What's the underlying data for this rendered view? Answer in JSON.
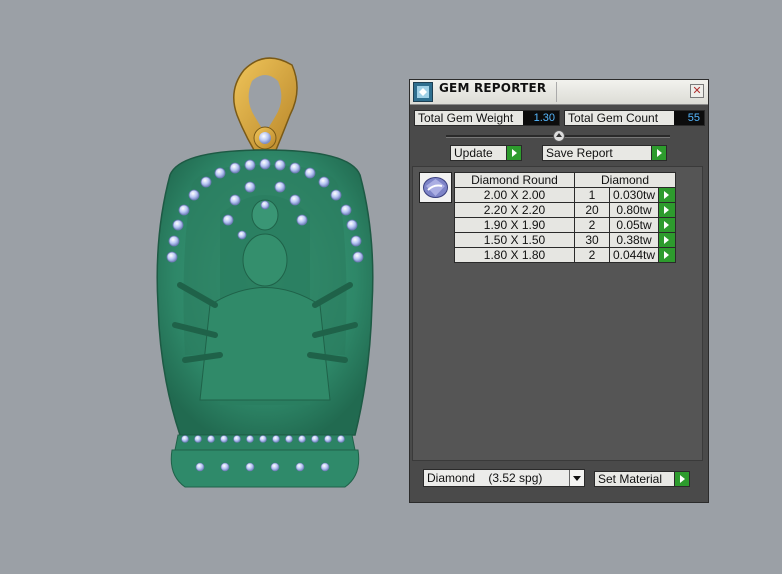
{
  "window": {
    "title": "GEM REPORTER",
    "close_glyph": "✕"
  },
  "stats": {
    "weight_label": "Total Gem Weight",
    "weight_value": "1.30",
    "count_label": "Total Gem Count",
    "count_value": "55"
  },
  "buttons": {
    "update": "Update",
    "save_report": "Save Report",
    "set_material": "Set Material"
  },
  "table": {
    "header_shape": "Diamond Round",
    "header_material": "Diamond",
    "rows": [
      {
        "size": "2.00 X 2.00",
        "count": "1",
        "weight": "0.030tw"
      },
      {
        "size": "2.20 X 2.20",
        "count": "20",
        "weight": "0.80tw"
      },
      {
        "size": "1.90 X 1.90",
        "count": "2",
        "weight": "0.05tw"
      },
      {
        "size": "1.50 X 1.50",
        "count": "30",
        "weight": "0.38tw"
      },
      {
        "size": "1.80 X 1.80",
        "count": "2",
        "weight": "0.044tw"
      }
    ]
  },
  "material_select": {
    "value": "Diamond    (3.52 spg)"
  },
  "icons": {
    "title": "gem-reporter-app-icon",
    "thumb": "round-diamond-icon",
    "close": "close-icon",
    "go": "play-arrow-icon",
    "dropdown": "chevron-down-icon"
  },
  "colors": {
    "panel_bg": "#4a4a4a",
    "go_green": "#2d9b2d",
    "value_text": "#55b8ff",
    "jade": "#2f8a6a",
    "gold": "#d4a437",
    "gem_blue": "#b9c8f4"
  }
}
